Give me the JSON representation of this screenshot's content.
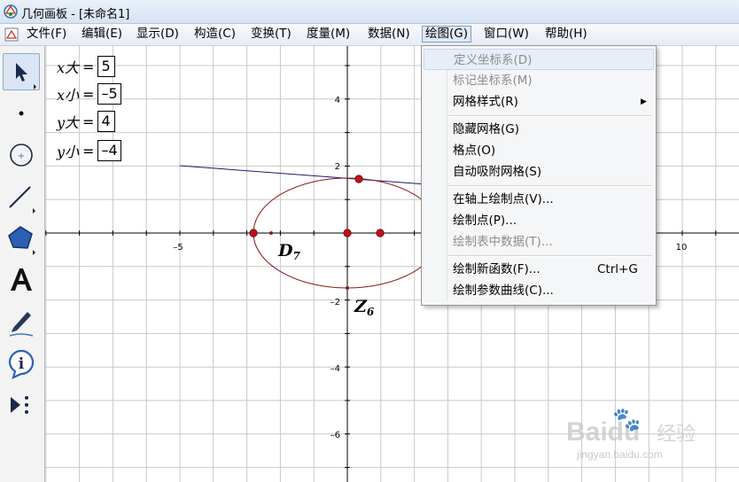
{
  "window": {
    "title": "几何画板 - [未命名1]"
  },
  "menubar": {
    "items": [
      "文件(F)",
      "编辑(E)",
      "显示(D)",
      "构造(C)",
      "变换(T)",
      "度量(M)",
      "数据(N)",
      "绘图(G)",
      "窗口(W)",
      "帮助(H)"
    ],
    "active": "绘图(G)"
  },
  "toolbox": {
    "tools": [
      "arrow-select-tool",
      "point-tool",
      "compass-tool",
      "straightedge-tool",
      "polygon-tool",
      "text-tool",
      "marker-tool",
      "information-tool",
      "custom-tool"
    ],
    "selected": "arrow-select-tool"
  },
  "params": [
    {
      "name": "x大",
      "value": "5"
    },
    {
      "name": "x小",
      "value": "–5"
    },
    {
      "name": "y大",
      "value": "4"
    },
    {
      "name": "y小",
      "value": "–4"
    }
  ],
  "graph": {
    "x_tick_labels": [
      "–5",
      "10"
    ],
    "y_tick_labels": [
      "4",
      "2",
      "–2",
      "–4",
      "–6"
    ],
    "labels": {
      "d_main": "D",
      "d_sub": "7",
      "z_main": "Z",
      "z_sub": "6"
    },
    "colors": {
      "axis": "#000000",
      "grid": "#c8c8c8",
      "ellipse": "#8b1a1a",
      "line": "#1a1a6e",
      "point": "#c0101a"
    }
  },
  "dropdown": {
    "items": [
      {
        "label": "定义坐标系(D)",
        "disabled": true,
        "hover": true
      },
      {
        "label": "标记坐标系(M)",
        "disabled": true
      },
      {
        "label": "网格样式(R)",
        "submenu": true
      },
      {
        "label": "隐藏网格(G)"
      },
      {
        "label": "格点(O)"
      },
      {
        "label": "自动吸附网格(S)"
      },
      {
        "label": "在轴上绘制点(V)..."
      },
      {
        "label": "绘制点(P)..."
      },
      {
        "label": "绘制表中数据(T)...",
        "disabled": true
      },
      {
        "label": "绘制新函数(F)...",
        "shortcut": "Ctrl+G"
      },
      {
        "label": "绘制参数曲线(C)..."
      }
    ]
  },
  "watermark": {
    "brand": "Baidu",
    "paw_char": "🐾",
    "suffix": "经验",
    "url": "jingyan.baidu.com"
  }
}
